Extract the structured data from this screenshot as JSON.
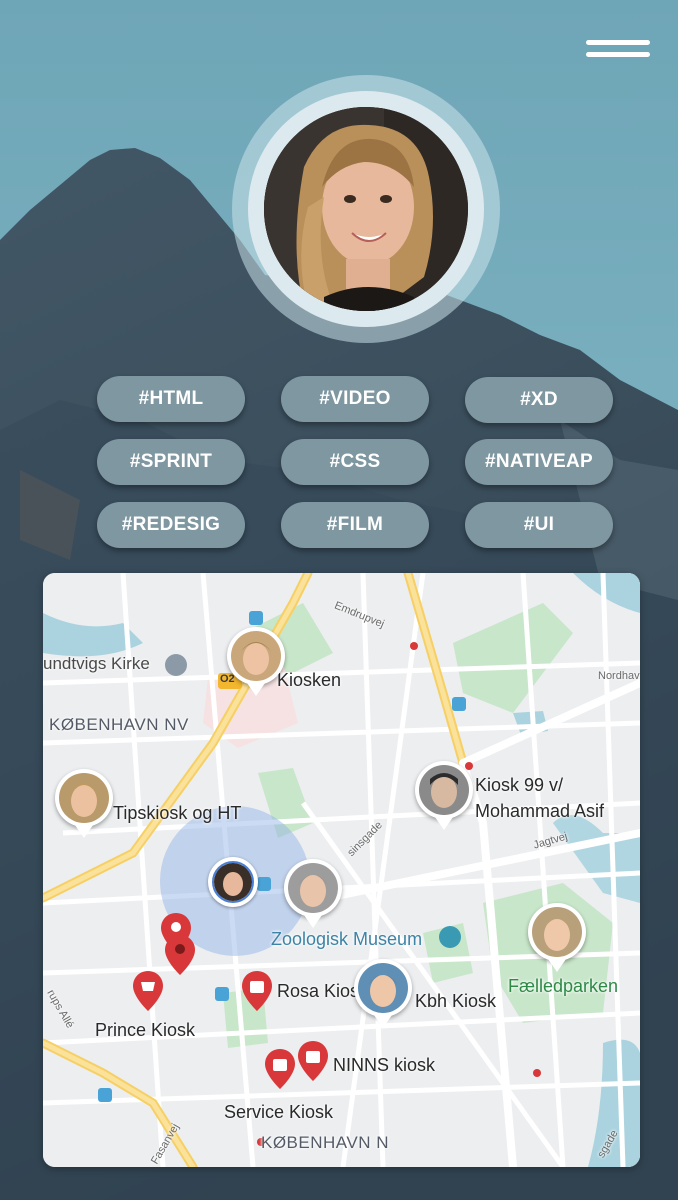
{
  "header": {
    "menu_icon": "hamburger-menu-icon"
  },
  "profile": {
    "avatar_icon": "profile-avatar"
  },
  "tags": [
    "#HTML",
    "#VIDEO",
    "#XD",
    "#SPRINT",
    "#CSS",
    "#NATIVEAP",
    "#REDESIG",
    "#FILM",
    "#UI"
  ],
  "map": {
    "area_labels": [
      "KØBENHAVN NV",
      "KØBENHAVN N"
    ],
    "place_labels": {
      "church": "undtvigs Kirke",
      "museum": "Zoologisk Museum",
      "park": "Fælledparken",
      "nordhavn": "Nordhavn"
    },
    "street_labels": [
      "Emdrupvej",
      "Jagtvej",
      "sinsgade",
      "rups Allé",
      "Fasanvej",
      "sgade"
    ],
    "road_badge": "O2",
    "kiosks": [
      "Kiosken",
      "Tipskiosk og HT",
      "Kiosk 99 v/",
      "Mohammad Asif",
      "Rosa Kios",
      "Kbh Kiosk",
      "Prince Kiosk",
      "NINNS kiosk",
      "Service Kiosk"
    ]
  },
  "colors": {
    "sky": "#7aaebe",
    "mountain": "#3b4f5e",
    "tag_bg": "#7e97a1",
    "pin_red": "#d9383a",
    "accent_blue": "#4a7fd6"
  }
}
